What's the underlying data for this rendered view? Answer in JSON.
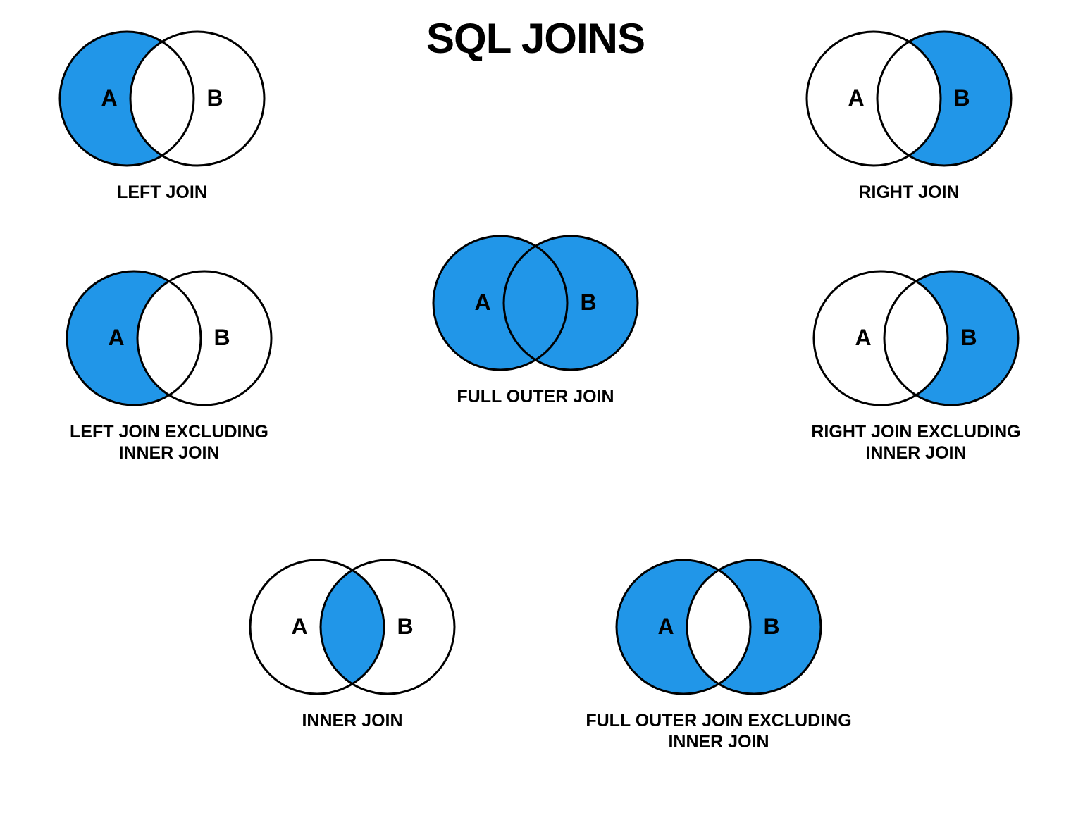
{
  "title": "SQL JOINS",
  "colors": {
    "fill": "#2196e8",
    "stroke": "#000000",
    "background": "#ffffff"
  },
  "labels": {
    "a": "A",
    "b": "B"
  },
  "diagrams": {
    "left_join": "LEFT JOIN",
    "right_join": "RIGHT JOIN",
    "full_outer_join": "FULL OUTER JOIN",
    "left_join_excluding": "LEFT JOIN EXCLUDING INNER JOIN",
    "right_join_excluding": "RIGHT JOIN EXCLUDING INNER JOIN",
    "inner_join": "INNER JOIN",
    "full_outer_excluding": "FULL OUTER JOIN EXCLUDING INNER JOIN"
  }
}
